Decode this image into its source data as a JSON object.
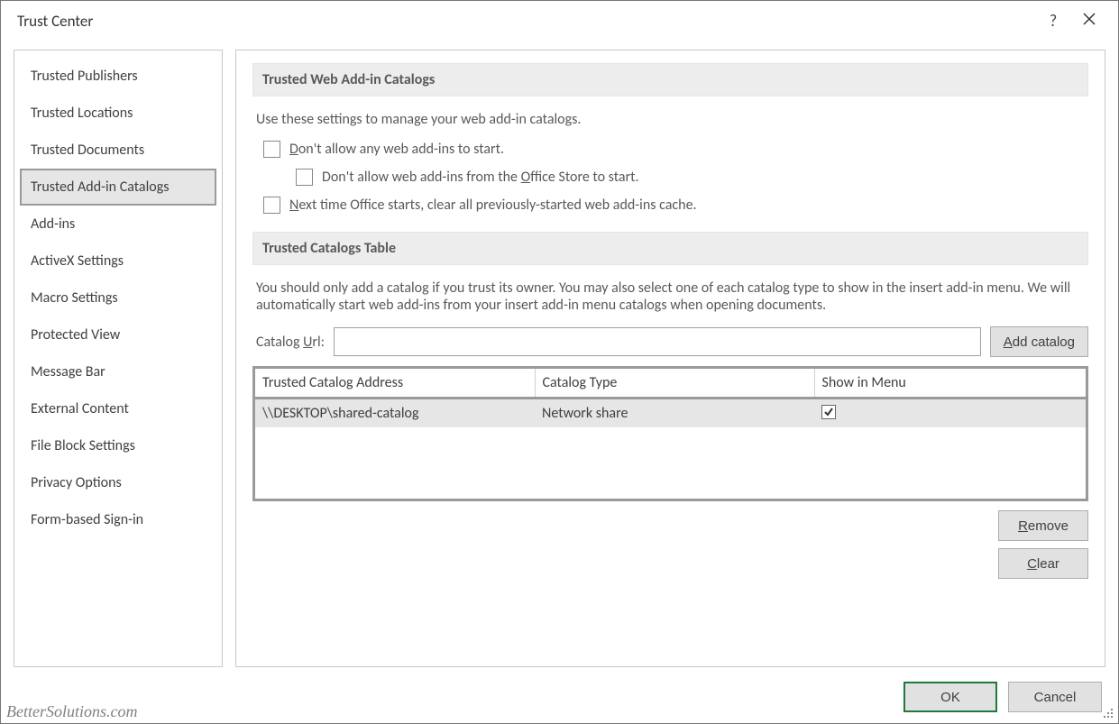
{
  "window": {
    "title": "Trust Center",
    "help_symbol": "?"
  },
  "sidebar": {
    "items": [
      {
        "id": "trusted-publishers",
        "label": "Trusted Publishers",
        "selected": false
      },
      {
        "id": "trusted-locations",
        "label": "Trusted Locations",
        "selected": false
      },
      {
        "id": "trusted-documents",
        "label": "Trusted Documents",
        "selected": false
      },
      {
        "id": "trusted-addin-catalogs",
        "label": "Trusted Add-in Catalogs",
        "selected": true
      },
      {
        "id": "add-ins",
        "label": "Add-ins",
        "selected": false
      },
      {
        "id": "activex-settings",
        "label": "ActiveX Settings",
        "selected": false
      },
      {
        "id": "macro-settings",
        "label": "Macro Settings",
        "selected": false
      },
      {
        "id": "protected-view",
        "label": "Protected View",
        "selected": false
      },
      {
        "id": "message-bar",
        "label": "Message Bar",
        "selected": false
      },
      {
        "id": "external-content",
        "label": "External Content",
        "selected": false
      },
      {
        "id": "file-block-settings",
        "label": "File Block Settings",
        "selected": false
      },
      {
        "id": "privacy-options",
        "label": "Privacy Options",
        "selected": false
      },
      {
        "id": "form-based-sign-in",
        "label": "Form-based Sign-in",
        "selected": false
      }
    ]
  },
  "section1": {
    "title": "Trusted Web Add-in Catalogs",
    "desc": "Use these settings to manage your web add-in catalogs.",
    "opt_disallow_pre": "",
    "opt_disallow_u": "D",
    "opt_disallow_post": "on't allow any web add-ins to start.",
    "opt_officestore_pre": "Don't allow web add-ins from the ",
    "opt_officestore_u": "O",
    "opt_officestore_post": "ffice Store to start.",
    "opt_clearcache_pre": "",
    "opt_clearcache_u": "N",
    "opt_clearcache_post": "ext time Office starts, clear all previously-started web add-ins cache."
  },
  "section2": {
    "title": "Trusted Catalogs Table",
    "desc": "You should only add a catalog if you trust its owner. You may also select one of each catalog type to show in the insert add-in menu. We will automatically start web add-ins from your insert add-in menu catalogs when opening documents.",
    "url_label_pre": "Catalog ",
    "url_label_u": "U",
    "url_label_post": "rl:",
    "url_value": "",
    "add_btn_u": "A",
    "add_btn_post": "dd catalog",
    "table": {
      "headers": {
        "address": "Trusted Catalog Address",
        "type": "Catalog Type",
        "show": "Show in Menu"
      },
      "rows": [
        {
          "address": "\\\\DESKTOP\\shared-catalog",
          "type": "Network share",
          "show": true
        }
      ]
    },
    "remove_u": "R",
    "remove_post": "emove",
    "clear_u": "C",
    "clear_post": "lear"
  },
  "footer": {
    "ok": "OK",
    "cancel": "Cancel"
  },
  "watermark": "BetterSolutions.com"
}
